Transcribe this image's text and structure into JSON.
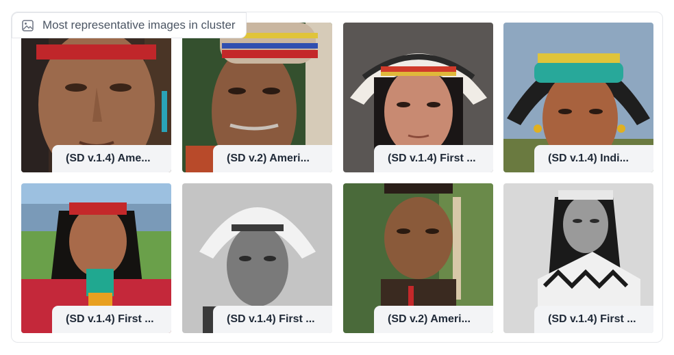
{
  "header": {
    "label": "Most representative images in cluster",
    "icon": "image-icon"
  },
  "images": [
    {
      "caption": "(SD v.1.4) Ame...",
      "subject": "portrait-1"
    },
    {
      "caption": "(SD v.2) Ameri...",
      "subject": "portrait-2"
    },
    {
      "caption": "(SD v.1.4) First ...",
      "subject": "portrait-3"
    },
    {
      "caption": "(SD v.1.4) Indi...",
      "subject": "portrait-4"
    },
    {
      "caption": "(SD v.1.4) First ...",
      "subject": "portrait-5"
    },
    {
      "caption": "(SD v.1.4) First ...",
      "subject": "portrait-6"
    },
    {
      "caption": "(SD v.2) Ameri...",
      "subject": "portrait-7"
    },
    {
      "caption": "(SD v.1.4) First ...",
      "subject": "portrait-8"
    }
  ]
}
